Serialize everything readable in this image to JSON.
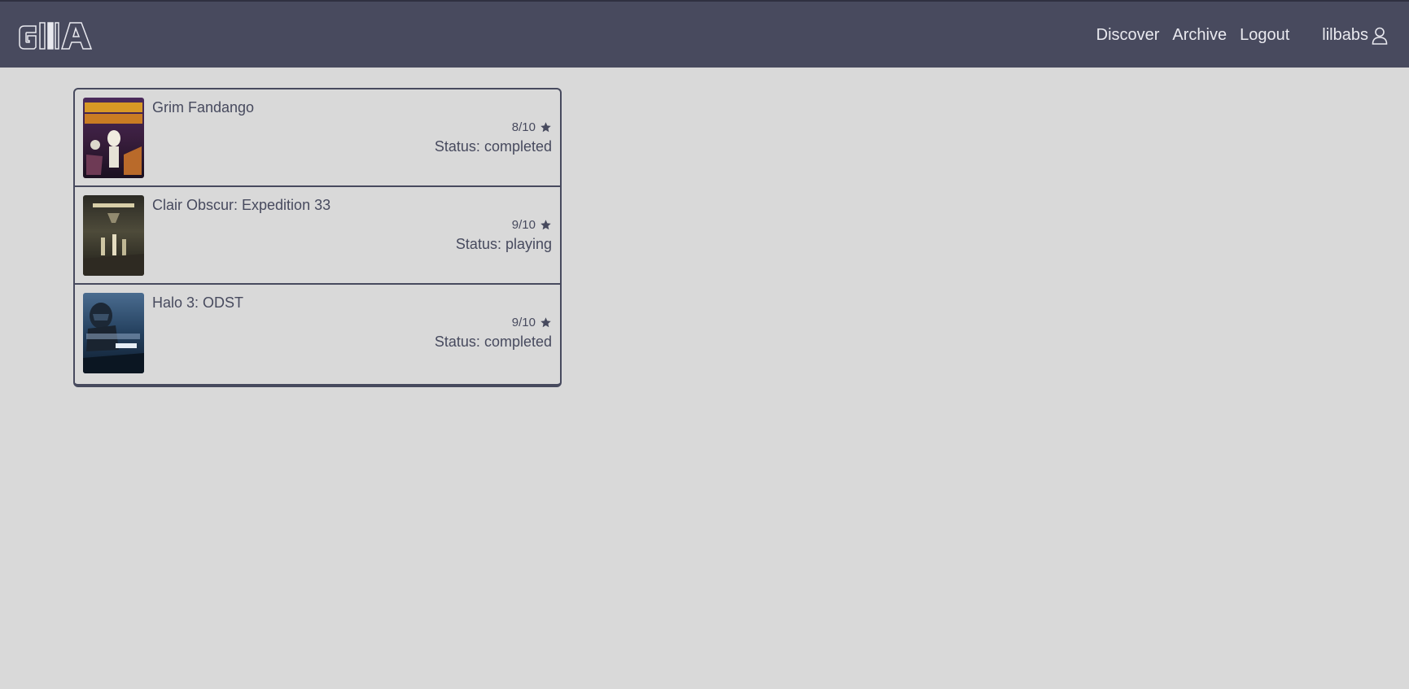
{
  "nav": {
    "logo_alt": "GIIA",
    "links": [
      "Discover",
      "Archive",
      "Logout"
    ],
    "username": "lilbabs"
  },
  "colors": {
    "navbar": "#484a5e",
    "background": "#d9d9d9",
    "text": "#474a5e"
  },
  "games": [
    {
      "title": "Grim Fandango",
      "rating": "8/10",
      "status": "Status: completed",
      "cover_icon": "grim-fandango-cover"
    },
    {
      "title": "Clair Obscur: Expedition 33",
      "rating": "9/10",
      "status": "Status: playing",
      "cover_icon": "expedition-33-cover"
    },
    {
      "title": "Halo 3: ODST",
      "rating": "9/10",
      "status": "Status: completed",
      "cover_icon": "halo-odst-cover"
    }
  ]
}
